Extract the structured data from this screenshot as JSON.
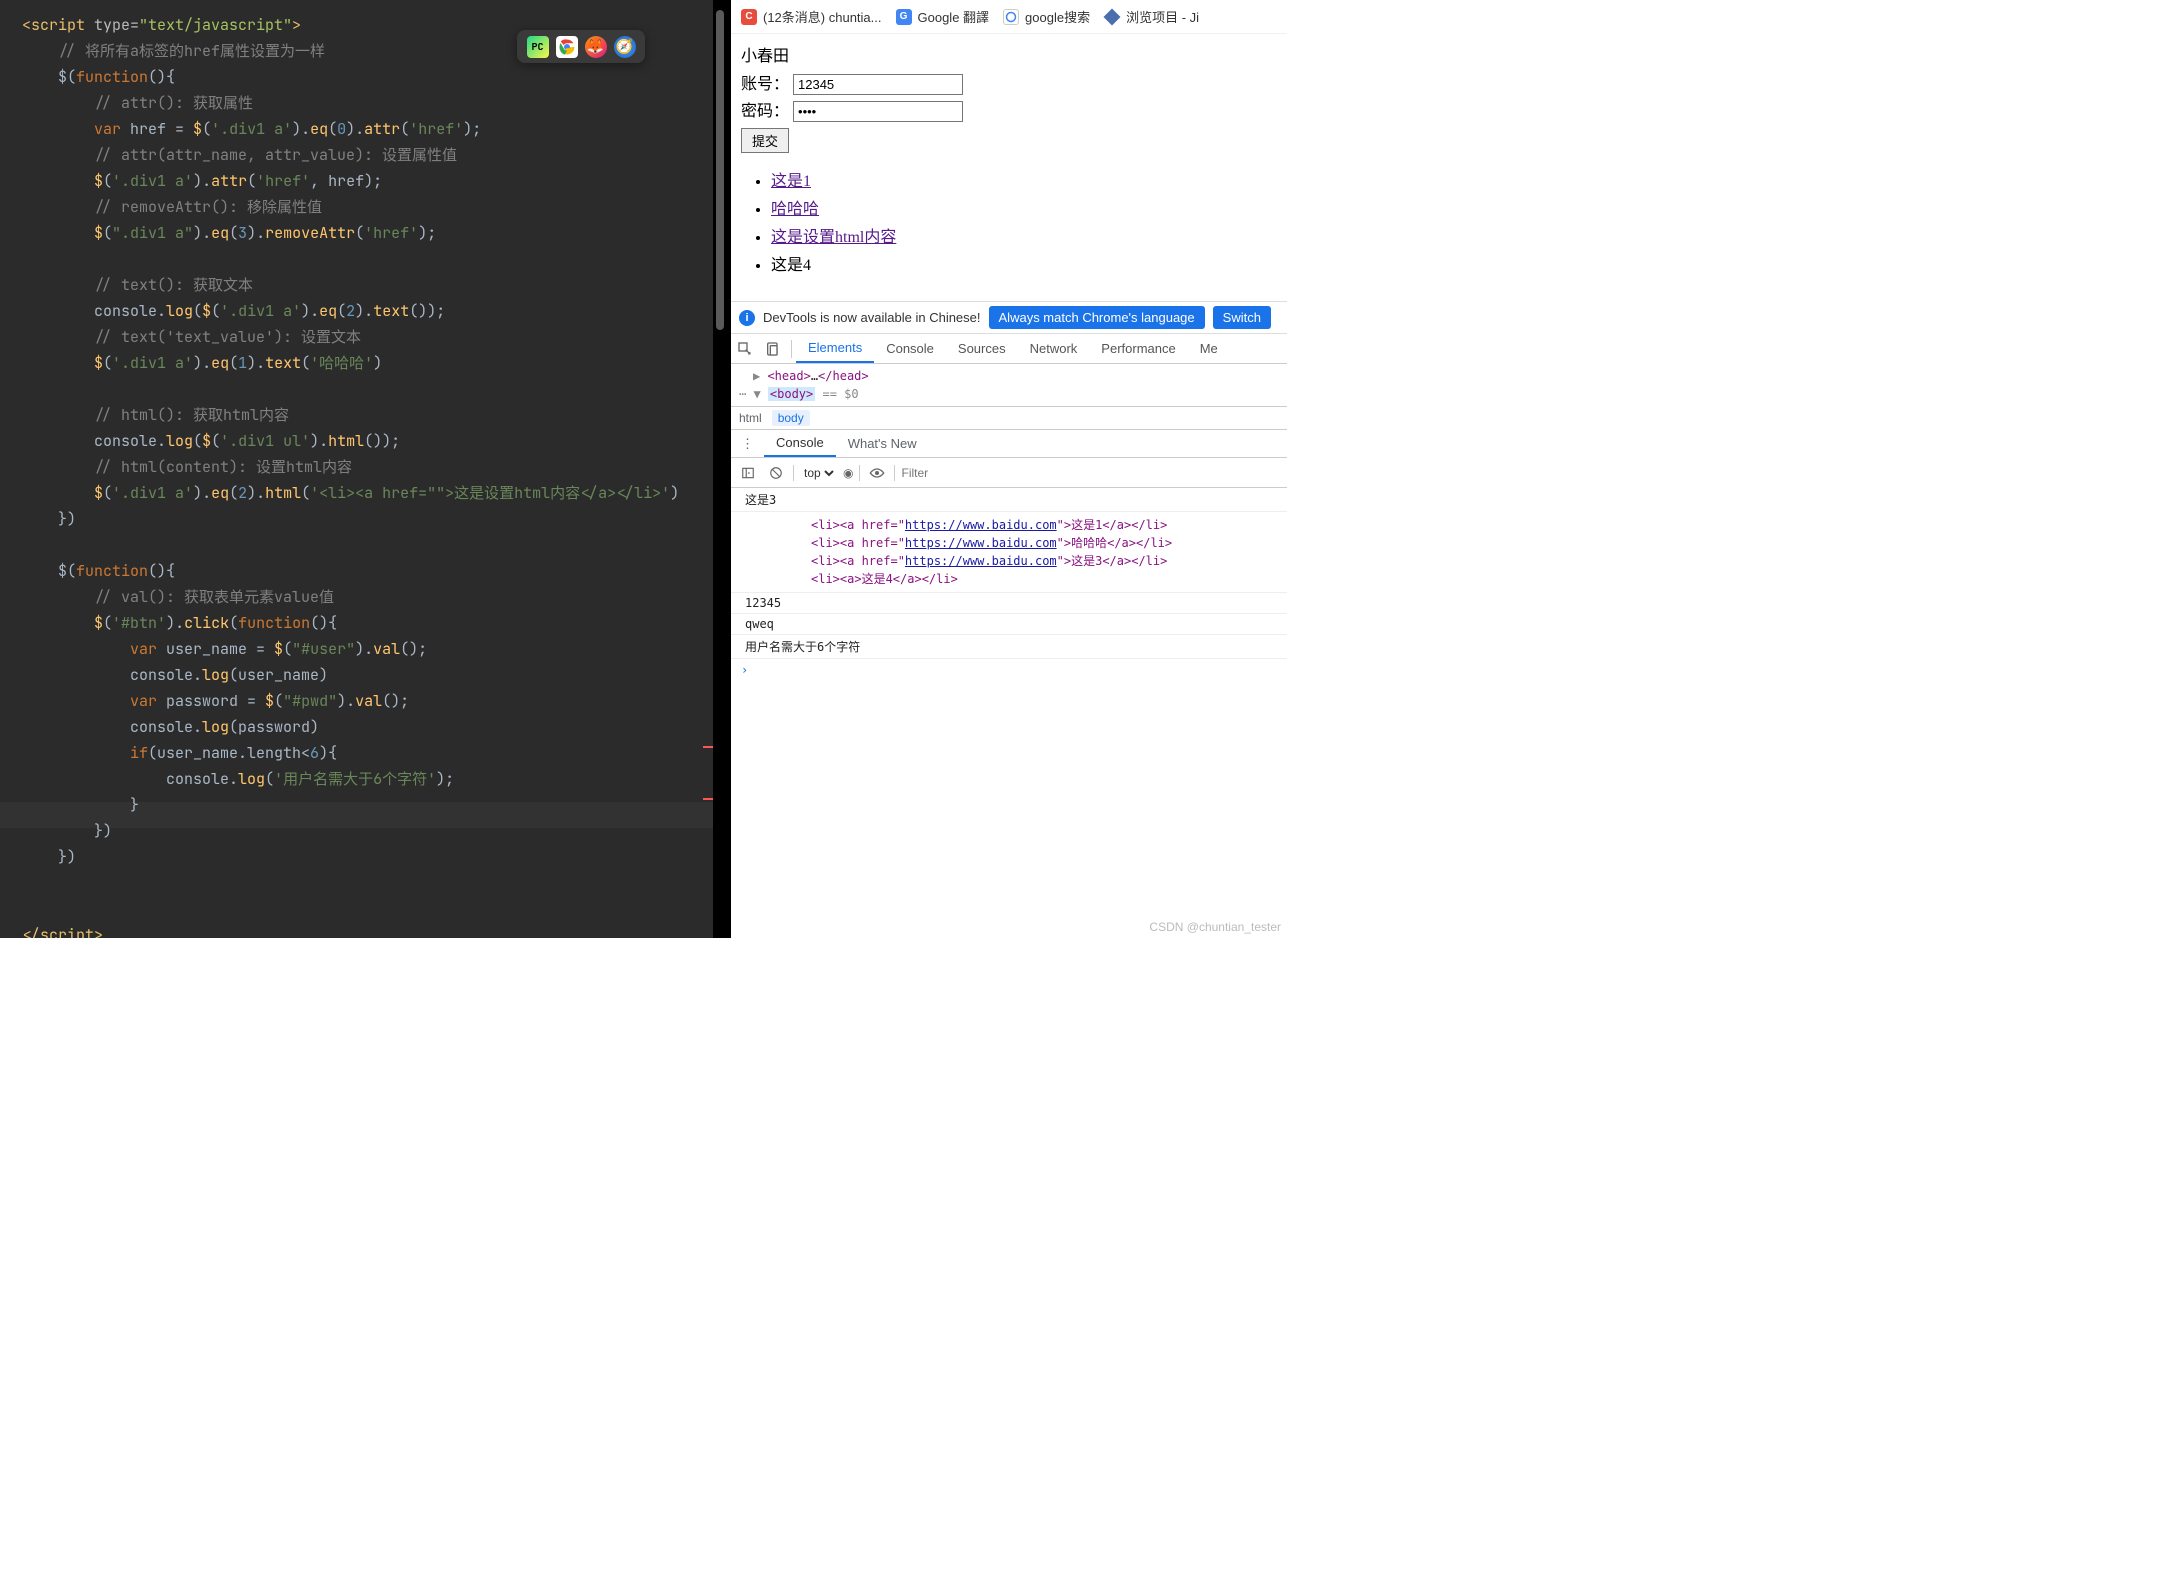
{
  "code": {
    "script_open": "<script type=\"text/javascript\">",
    "c1": "// 将所有a标签的href属性设置为一样",
    "l1": "$(function(){",
    "c2": "// attr(): 获取属性",
    "l2": "var href = $('.div1 a').eq(0).attr('href');",
    "c3": "// attr(attr_name, attr_value): 设置属性值",
    "l3": "$('.div1 a').attr('href', href);",
    "c4": "// removeAttr(): 移除属性值",
    "l4": "$(\".div1 a\").eq(3).removeAttr('href');",
    "c5": "// text(): 获取文本",
    "l5": "console.log($('.div1 a').eq(2).text());",
    "c6": "// text('text_value'): 设置文本",
    "l6": "$('.div1 a').eq(1).text('哈哈哈')",
    "c7": "// html(): 获取html内容",
    "l7": "console.log($('.div1 ul').html());",
    "c8": "// html(content): 设置html内容",
    "l8": "$('.div1 a').eq(2).html('<li><a href=\"\">这是设置html内容</a></li>')",
    "end1": "})",
    "l9": "$(function(){",
    "c9": "// val(): 获取表单元素value值",
    "l10": "$('#btn').click(function(){",
    "l11": "var user_name = $(\"#user\").val();",
    "l12": "console.log(user_name)",
    "l13": "var password = $(\"#pwd\").val();",
    "l14": "console.log(password)",
    "l15": "if(user_name.length<6){",
    "l16": "console.log('用户名需大于6个字符');",
    "l17": "}",
    "end2": "})",
    "end3": "})",
    "script_close": "</script>"
  },
  "bookmarks": [
    {
      "label": "(12条消息) chuntia..."
    },
    {
      "label": "Google 翻譯"
    },
    {
      "label": "google搜索"
    },
    {
      "label": "浏览项目 - Ji"
    }
  ],
  "page": {
    "title": "小春田",
    "acct_label": "账号：",
    "acct_value": "12345",
    "pwd_label": "密码：",
    "pwd_value": "qweq",
    "submit": "提交",
    "list": [
      {
        "text": "这是1",
        "link": true
      },
      {
        "text": "哈哈哈",
        "link": true
      },
      {
        "text": "这是设置html内容",
        "link": true
      },
      {
        "text": "这是4",
        "link": false
      }
    ]
  },
  "banner": {
    "text": "DevTools is now available in Chinese!",
    "btn1": "Always match Chrome's language",
    "btn2": "Switch"
  },
  "tabs": {
    "elements": "Elements",
    "console": "Console",
    "sources": "Sources",
    "network": "Network",
    "performance": "Performance",
    "more": "Me"
  },
  "dom": {
    "head": "<head>…</head>",
    "body": "<body>",
    "eq": " == $0"
  },
  "breadcrumb": {
    "a": "html",
    "b": "body"
  },
  "drawer": {
    "console": "Console",
    "whatsnew": "What's New"
  },
  "toolbar": {
    "ctx": "top",
    "filter_ph": "Filter"
  },
  "console": {
    "r1": "这是3",
    "url": "https://www.baidu.com",
    "h1a": "<li><a href=\"",
    "h1b": "\">这是1</a></li>",
    "h2b": "\">哈哈哈</a></li>",
    "h3b": "\">这是3</a></li>",
    "h4": "<li><a>这是4</a></li>",
    "r2": "12345",
    "r3": "qweq",
    "r4": "用户名需大于6个字符"
  },
  "watermark": "CSDN @chuntian_tester"
}
